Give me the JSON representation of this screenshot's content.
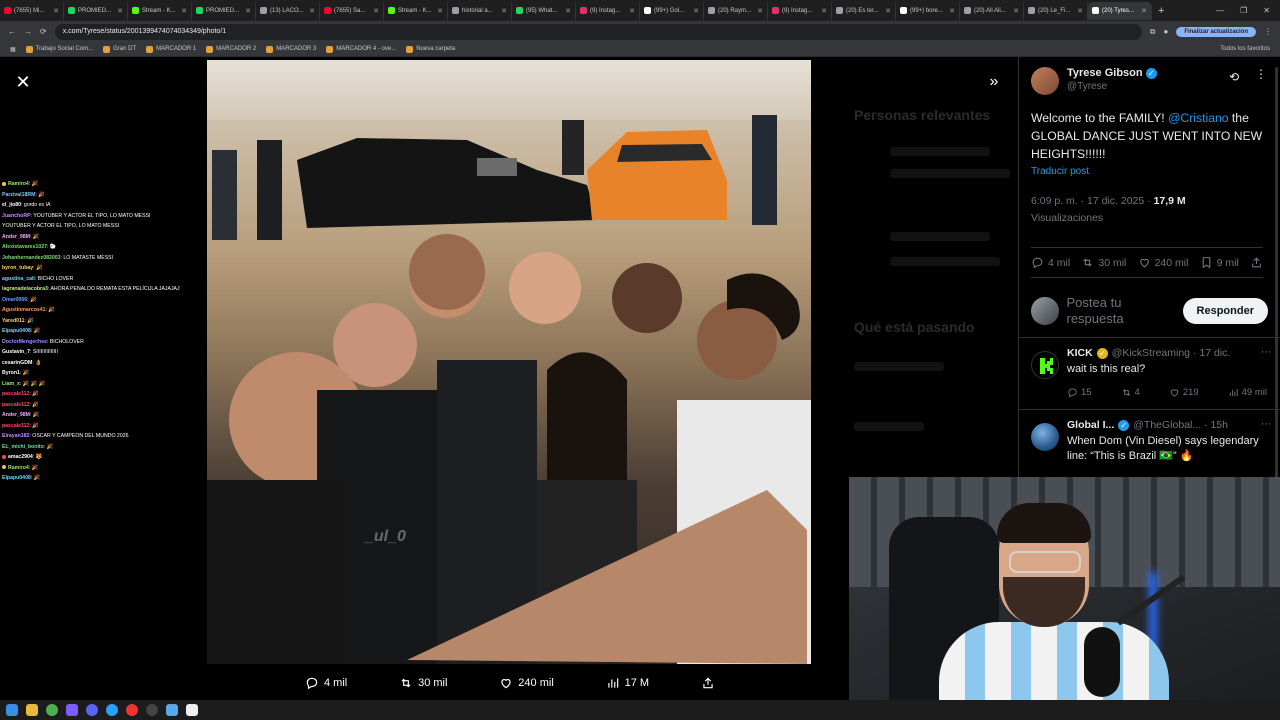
{
  "browser": {
    "tabs": [
      {
        "label": "(7655) Mi...",
        "color": "#ff0033",
        "active": false
      },
      {
        "label": "PROMIED...",
        "color": "#1ed760",
        "active": false
      },
      {
        "label": "Stream - K...",
        "color": "#53fc18",
        "active": false
      },
      {
        "label": "PROMIED...",
        "color": "#1ed760",
        "active": false
      },
      {
        "label": "(13) LACO...",
        "color": "#9aa0a6",
        "active": false
      },
      {
        "label": "(7655) Sa...",
        "color": "#ff0033",
        "active": false
      },
      {
        "label": "Stream - K...",
        "color": "#53fc18",
        "active": false
      },
      {
        "label": "historial a...",
        "color": "#9aa0a6",
        "active": false
      },
      {
        "label": "(95) What...",
        "color": "#25d366",
        "active": false
      },
      {
        "label": "(9) Instag...",
        "color": "#e1306c",
        "active": false
      },
      {
        "label": "(99+) Gol...",
        "color": "#ffffff",
        "active": false
      },
      {
        "label": "(20) Raym...",
        "color": "#9aa0a6",
        "active": false
      },
      {
        "label": "(9) Instag...",
        "color": "#e1306c",
        "active": false
      },
      {
        "label": "(20) Es ter...",
        "color": "#9aa0a6",
        "active": false
      },
      {
        "label": "(99+) bore...",
        "color": "#ffffff",
        "active": false
      },
      {
        "label": "(20) All Ali...",
        "color": "#9aa0a6",
        "active": false
      },
      {
        "label": "(20) Le_Fi...",
        "color": "#9aa0a6",
        "active": false
      },
      {
        "label": "(20) Tyres...",
        "color": "#ffffff",
        "active": true
      }
    ],
    "new_tab": "+",
    "url": "x.com/Tyrese/status/2001399474074034349/photo/1",
    "update_button": "Finalizar actualización",
    "bookmarks": [
      "Trabajo Social Com...",
      "Gran DT",
      "MARCADOR 1",
      "MARCADOR 2",
      "MARCADOR 3",
      "MARCADOR 4 - ove...",
      "Nueva carpeta"
    ],
    "bookmarks_all": "Todos los favoritos"
  },
  "background_ghost": {
    "relevant": "Personas relevantes",
    "trending": "Qué está pasando"
  },
  "chat": [
    {
      "user": "Ramiro4",
      "text": ": 🎉",
      "color": "#9fe86a",
      "dot": "#f6c445"
    },
    {
      "user": "Parzival18RM",
      "text": ": 🎉",
      "color": "#7fc8ff",
      "dot": ""
    },
    {
      "user": "el_jio80",
      "text": ": gordo es IA",
      "color": "#ffffff",
      "dot": ""
    },
    {
      "user": "JuanchoRP",
      "text": ": YOUTUBER Y ACTOR EL TIPO, LO MATO MESSI",
      "color": "#c98bff",
      "dot": ""
    },
    {
      "user": "",
      "text": "YOUTUBER Y ACTOR EL TIPO, LO MATO MESSI",
      "color": "#ffffff",
      "dot": ""
    },
    {
      "user": "Ander_98M",
      "text": ": 🎉",
      "color": "#f5a3ff",
      "dot": ""
    },
    {
      "user": "Alexistavares1027",
      "text": ": 🐑",
      "color": "#68e06b",
      "dot": ""
    },
    {
      "user": "Johanhernandez082003",
      "text": ": LO MATASTE MESSI",
      "color": "#7fdc6a",
      "dot": ""
    },
    {
      "user": "byron_tubay",
      "text": ": 🎉",
      "color": "#ffd36a",
      "dot": ""
    },
    {
      "user": "agustina_cali",
      "text": ": BICHO LOVER",
      "color": "#6ad7ff",
      "dot": ""
    },
    {
      "user": "lagranadelacobra3",
      "text": ": AHORA PENALDO REMATA ESTA PELÍCULA JAJAJAJ",
      "color": "#c4f06a",
      "dot": ""
    },
    {
      "user": "Omar0066",
      "text": ": 🎉",
      "color": "#6aa0ff",
      "dot": ""
    },
    {
      "user": "Agustinmarcos41",
      "text": ": 🎉",
      "color": "#ff9a6a",
      "dot": ""
    },
    {
      "user": "Yared011",
      "text": ": 🎉",
      "color": "#ffd36a",
      "dot": ""
    },
    {
      "user": "Elpapu0408",
      "text": ": 🎉",
      "color": "#6ad7ff",
      "dot": ""
    },
    {
      "user": "DoctorMengechee",
      "text": ": BICHOLOVER",
      "color": "#a38bff",
      "dot": ""
    },
    {
      "user": "Gustavin_7",
      "text": ": SIIIIIIIIIIIIIII",
      "color": "#ffffff",
      "dot": ""
    },
    {
      "user": "cesarinGDM",
      "text": ": 👌",
      "color": "#ffffff",
      "dot": ""
    },
    {
      "user": "Byron1",
      "text": ": 🎉",
      "color": "#ffffff",
      "dot": ""
    },
    {
      "user": "Liam_x",
      "text": ": 🎉 🎉 🎉",
      "color": "#9fe86a",
      "dot": ""
    },
    {
      "user": "pascale112",
      "text": ": 🎉",
      "color": "#ff4a6a",
      "dot": ""
    },
    {
      "user": "pascale112",
      "text": ": 🎉",
      "color": "#ff4a6a",
      "dot": ""
    },
    {
      "user": "Ander_98M",
      "text": ": 🎉",
      "color": "#f5a3ff",
      "dot": ""
    },
    {
      "user": "pascale112",
      "text": ": 🎉",
      "color": "#ff4a6a",
      "dot": ""
    },
    {
      "user": "Elrayan182",
      "text": ": OSCAR Y CAMPEON DEL MUNDO 2026",
      "color": "#c98bff",
      "dot": ""
    },
    {
      "user": "EL_michi_bonito",
      "text": ": 🎉",
      "color": "#6ae0a0",
      "dot": ""
    },
    {
      "user": "amac2904",
      "text": ": 🐯",
      "color": "#ffffff",
      "dot": "#ff4a4a"
    },
    {
      "user": "Ramiro4",
      "text": ": 🎉",
      "color": "#9fe86a",
      "dot": "#f6c445"
    },
    {
      "user": "Elpapu0408",
      "text": ": 🎉",
      "color": "#6ad7ff",
      "dot": ""
    }
  ],
  "photo": {
    "watermark": "_ul_0"
  },
  "viewer_actions": {
    "replies": "4 mil",
    "reposts": "30 mil",
    "likes": "240 mil",
    "views": "17 M"
  },
  "tweet": {
    "author_name": "Tyrese Gibson",
    "author_handle": "@Tyrese",
    "text_before": "Welcome to the FAMILY! ",
    "mention": "@Cristiano",
    "text_after": " the GLOBAL DANCE JUST WENT INTO NEW HEIGHTS!!!!!!",
    "translate": "Traducir post",
    "time": "6:09 p. m. · 17 dic. 2025 · ",
    "views_count": "17,9 M",
    "views_label": "Visualizaciones",
    "stats": {
      "replies": "4 mil",
      "reposts": "30 mil",
      "likes": "240 mil",
      "bookmarks": "9 mil"
    }
  },
  "reply_box": {
    "placeholder": "Postea tu respuesta",
    "button": "Responder"
  },
  "replies": [
    {
      "name": "KICK",
      "handle": "@KickStreaming · 17 dic.",
      "text": "wait is this real?",
      "avatar_color": "#000000",
      "badge": "gold",
      "stats": {
        "replies": "15",
        "reposts": "4",
        "likes": "219",
        "views": "49 mil"
      }
    },
    {
      "name": "Global I...",
      "handle": "@TheGlobal... · 15h",
      "text": "When Dom (Vin Diesel) says legendary line: “This is Brazil 🇧🇷” 🔥",
      "avatar_color": "#3b6ea8",
      "badge": "blue"
    }
  ]
}
